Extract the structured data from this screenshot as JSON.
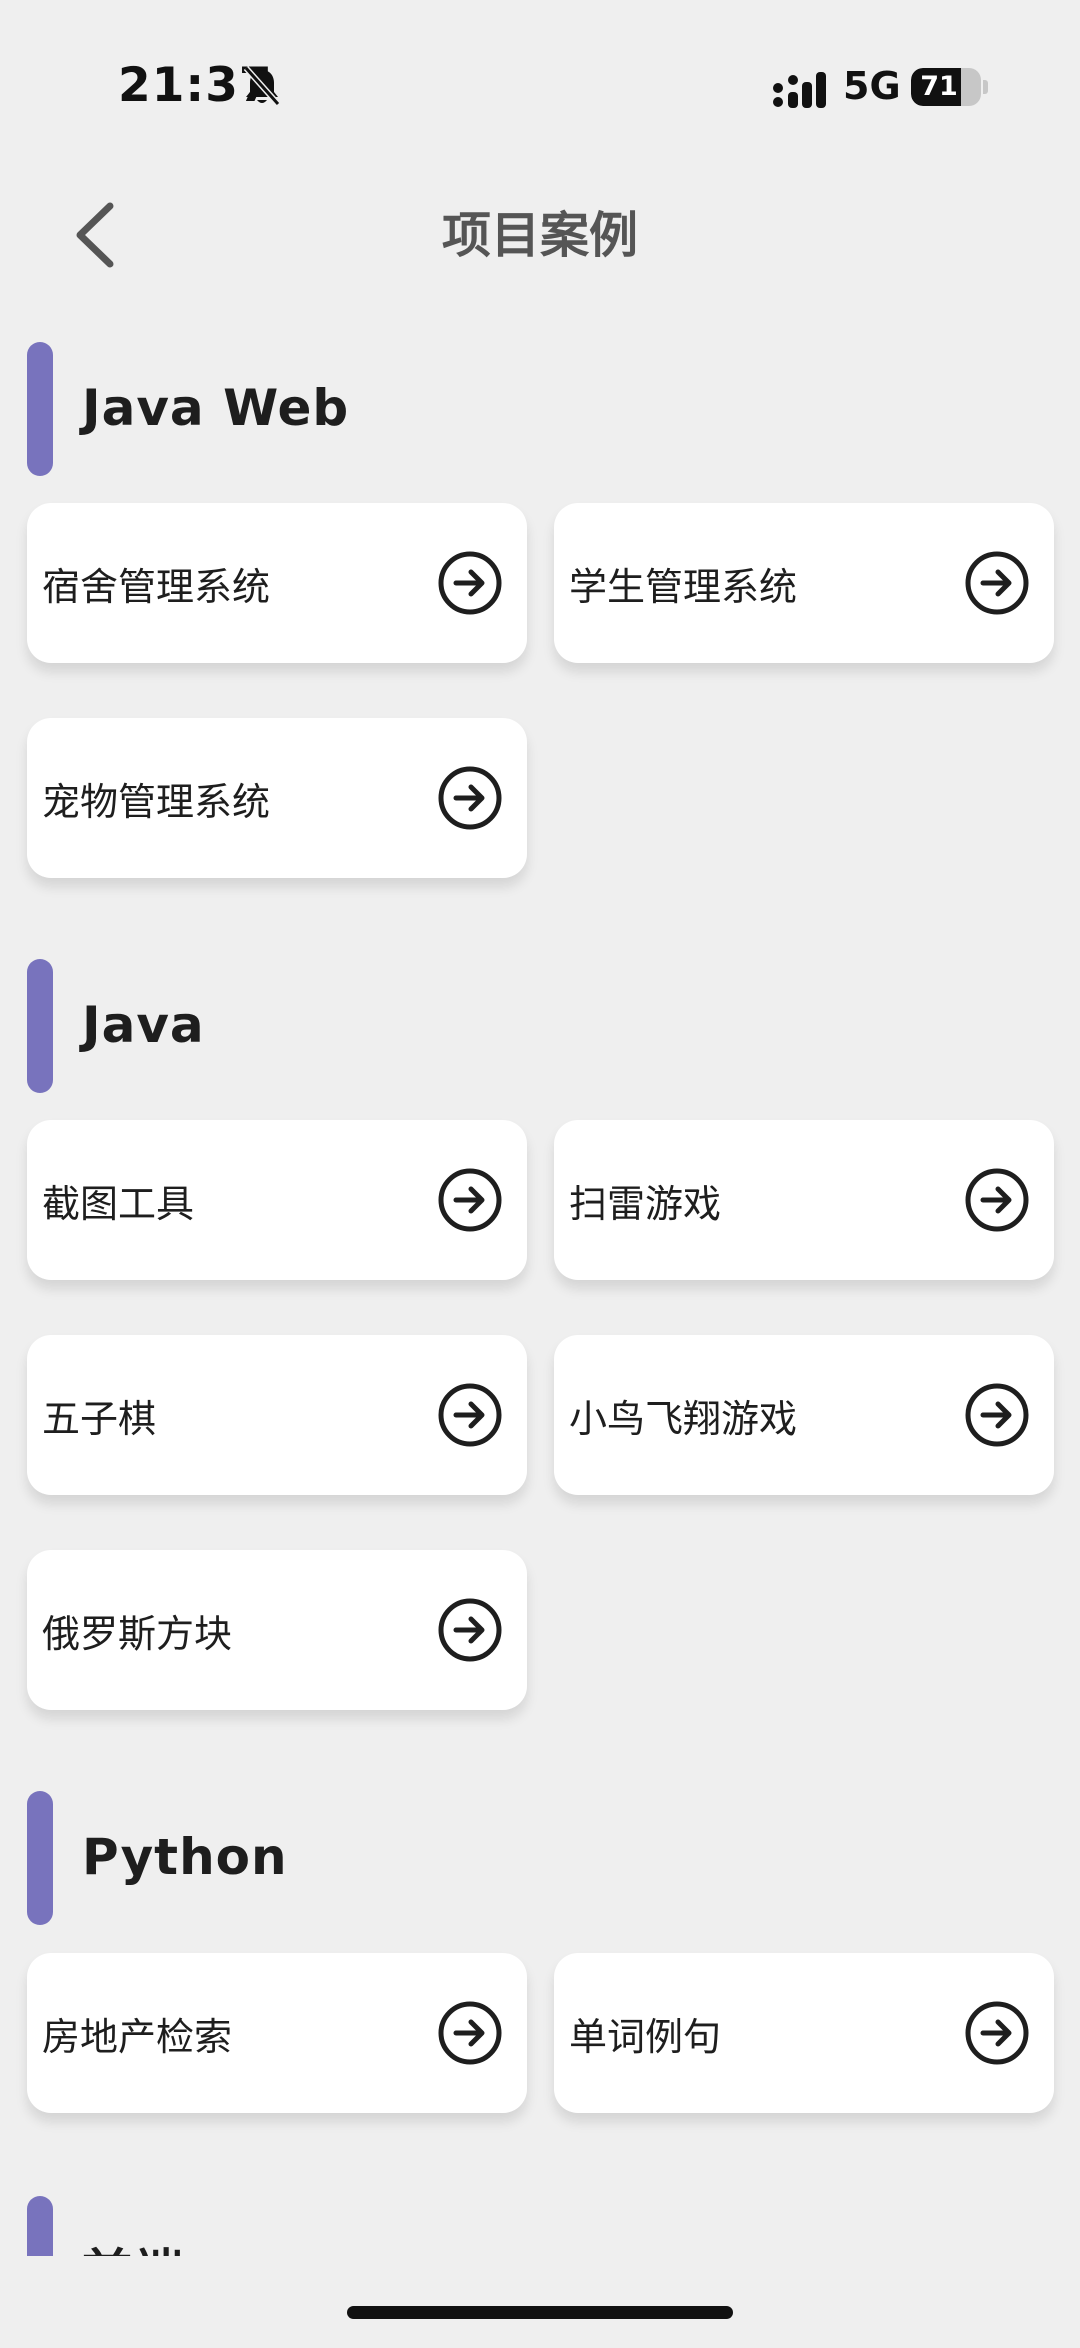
{
  "status_bar": {
    "time": "21:37",
    "network": "5G",
    "battery": "71",
    "battery_level": 0.71
  },
  "header": {
    "title": "项目案例",
    "back_icon": "chevron-left-icon"
  },
  "sections": [
    {
      "title": "Java Web",
      "items": [
        {
          "label": "宿舍管理系统"
        },
        {
          "label": "学生管理系统"
        },
        {
          "label": "宠物管理系统"
        }
      ]
    },
    {
      "title": "Java",
      "items": [
        {
          "label": "截图工具"
        },
        {
          "label": "扫雷游戏"
        },
        {
          "label": "五子棋"
        },
        {
          "label": "小鸟飞翔游戏"
        },
        {
          "label": "俄罗斯方块"
        }
      ]
    },
    {
      "title": "Python",
      "items": [
        {
          "label": "房地产检索"
        },
        {
          "label": "单词例句"
        }
      ]
    },
    {
      "title": "前端",
      "items": []
    }
  ],
  "colors": {
    "accent": "#7873bd",
    "background": "#efefef",
    "card": "#ffffff"
  },
  "icons": {
    "card_arrow": "arrow-right-circle-icon"
  }
}
